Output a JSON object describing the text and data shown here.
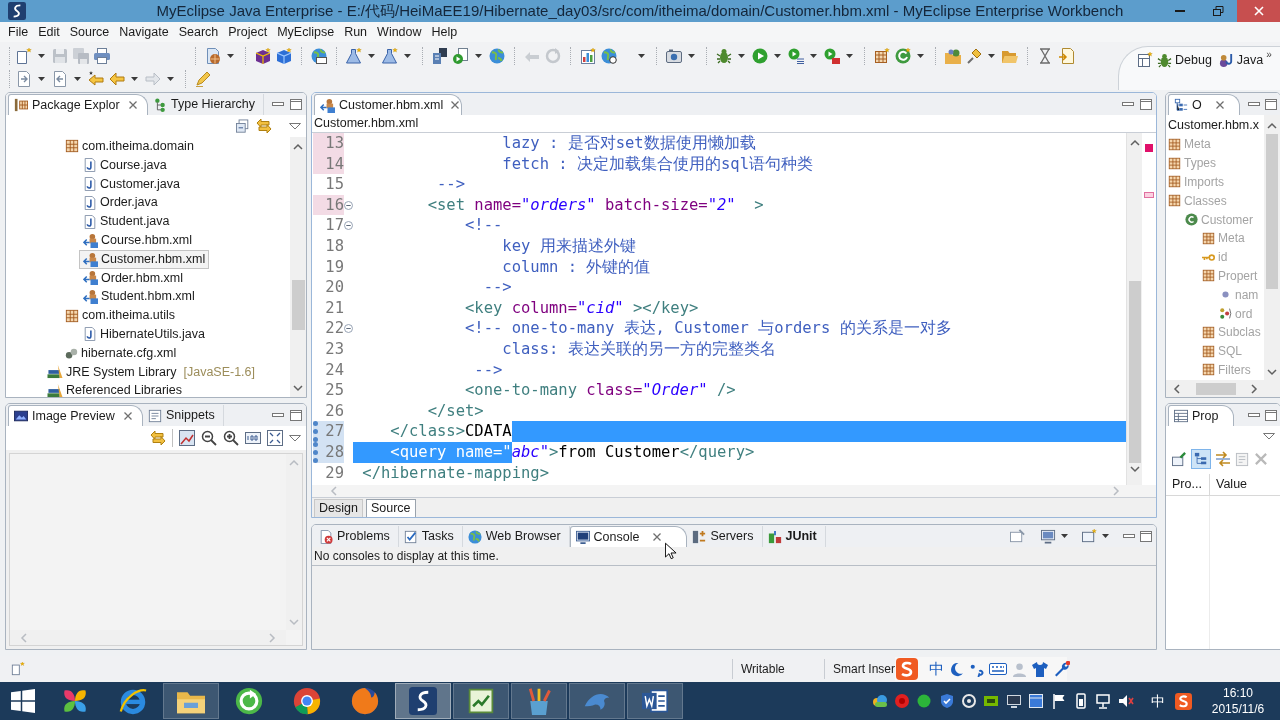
{
  "window": {
    "title": "MyEclipse Java Enterprise - E:/代码/HeiMaEE19/Hibernate_day03/src/com/itheima/domain/Customer.hbm.xml - MyEclipse Enterprise Workbench"
  },
  "menu": [
    "File",
    "Edit",
    "Source",
    "Navigate",
    "Search",
    "Project",
    "MyEclipse",
    "Run",
    "Window",
    "Help"
  ],
  "perspectives": {
    "items": [
      "Debug",
      "Java"
    ],
    "overflow": "»"
  },
  "package_explorer": {
    "tabs": [
      {
        "label": "Package Explor",
        "selected": true,
        "closable": true
      },
      {
        "label": "Type Hierarchy",
        "selected": false,
        "closable": false
      }
    ],
    "tree": [
      {
        "children": [
          {
            "label": "com.itheima.domain",
            "kind": "package",
            "selected": false,
            "children": [
              {
                "label": "Course.java",
                "kind": "java",
                "selected": false
              },
              {
                "label": "Customer.java",
                "kind": "java",
                "selected": false
              },
              {
                "label": "Order.java",
                "kind": "java",
                "selected": false
              },
              {
                "label": "Student.java",
                "kind": "java",
                "selected": false
              },
              {
                "label": "Course.hbm.xml",
                "kind": "mapping",
                "selected": false
              },
              {
                "label": "Customer.hbm.xml",
                "kind": "mapping",
                "selected": true
              },
              {
                "label": "Order.hbm.xml",
                "kind": "mapping",
                "selected": false
              },
              {
                "label": "Student.hbm.xml",
                "kind": "mapping",
                "selected": false
              }
            ]
          },
          {
            "label": "com.itheima.utils",
            "kind": "package",
            "selected": false,
            "children": [
              {
                "label": "HibernateUtils.java",
                "kind": "java",
                "selected": false
              }
            ]
          },
          {
            "label": "hibernate.cfg.xml",
            "kind": "config",
            "selected": false
          }
        ]
      },
      {
        "label": "JRE System Library",
        "decoration": "[JavaSE-1.6]",
        "kind": "library",
        "selected": false
      },
      {
        "label": "Referenced Libraries",
        "kind": "library",
        "selected": false
      }
    ]
  },
  "image_preview": {
    "tabs": [
      {
        "label": "Image Preview",
        "selected": true,
        "closable": true
      },
      {
        "label": "Snippets",
        "selected": false,
        "closable": false
      }
    ]
  },
  "editor": {
    "tabs": [
      {
        "label": "Customer.hbm.xml",
        "selected": true,
        "closable": true
      }
    ],
    "breadcrumb": "Customer.hbm.xml",
    "lines": [
      {
        "number": "13",
        "changed": true,
        "added": false,
        "foldable": false,
        "eol_selected": false,
        "tokens": [
          {
            "kind": "comment",
            "text": "                lazy : 是否对set数据使用懒加载",
            "selected": false
          }
        ]
      },
      {
        "number": "14",
        "changed": true,
        "added": false,
        "foldable": false,
        "eol_selected": false,
        "tokens": [
          {
            "kind": "comment",
            "text": "                fetch : 决定加载集合使用的sql语句种类",
            "selected": false
          }
        ]
      },
      {
        "number": "15",
        "changed": false,
        "added": false,
        "foldable": false,
        "eol_selected": false,
        "tokens": [
          {
            "kind": "comment",
            "text": "         -->",
            "selected": false
          }
        ]
      },
      {
        "number": "16",
        "changed": true,
        "added": false,
        "foldable": true,
        "eol_selected": false,
        "tokens": [
          {
            "kind": "tag",
            "text": "        <set",
            "selected": false
          },
          {
            "kind": "attribute",
            "text": " name=",
            "selected": false
          },
          {
            "kind": "value",
            "text": "\"orders\"",
            "selected": false
          },
          {
            "kind": "attribute",
            "text": " batch-size=",
            "selected": false
          },
          {
            "kind": "value",
            "text": "\"2\"",
            "selected": false
          },
          {
            "kind": "tag",
            "text": "  >",
            "selected": false
          }
        ]
      },
      {
        "number": "17",
        "changed": false,
        "added": false,
        "foldable": true,
        "eol_selected": false,
        "tokens": [
          {
            "kind": "comment",
            "text": "            <!--",
            "selected": false
          }
        ]
      },
      {
        "number": "18",
        "changed": false,
        "added": false,
        "foldable": false,
        "eol_selected": false,
        "tokens": [
          {
            "kind": "comment",
            "text": "                key 用来描述外键",
            "selected": false
          }
        ]
      },
      {
        "number": "19",
        "changed": false,
        "added": false,
        "foldable": false,
        "eol_selected": false,
        "tokens": [
          {
            "kind": "comment",
            "text": "                column : 外键的值",
            "selected": false
          }
        ]
      },
      {
        "number": "20",
        "changed": false,
        "added": false,
        "foldable": false,
        "eol_selected": false,
        "tokens": [
          {
            "kind": "comment",
            "text": "              -->",
            "selected": false
          }
        ]
      },
      {
        "number": "21",
        "changed": false,
        "added": false,
        "foldable": false,
        "eol_selected": false,
        "tokens": [
          {
            "kind": "tag",
            "text": "            <key",
            "selected": false
          },
          {
            "kind": "attribute",
            "text": " column=",
            "selected": false
          },
          {
            "kind": "value",
            "text": "\"cid\"",
            "selected": false
          },
          {
            "kind": "tag",
            "text": " ></key>",
            "selected": false
          }
        ]
      },
      {
        "number": "22",
        "changed": false,
        "added": false,
        "foldable": true,
        "eol_selected": false,
        "tokens": [
          {
            "kind": "comment",
            "text": "            <!-- one-to-many 表达, Customer 与orders 的关系是一对多",
            "selected": false
          }
        ]
      },
      {
        "number": "23",
        "changed": false,
        "added": false,
        "foldable": false,
        "eol_selected": false,
        "tokens": [
          {
            "kind": "comment",
            "text": "                class: 表达关联的另一方的完整类名",
            "selected": false
          }
        ]
      },
      {
        "number": "24",
        "changed": false,
        "added": false,
        "foldable": false,
        "eol_selected": false,
        "tokens": [
          {
            "kind": "comment",
            "text": "             -->",
            "selected": false
          }
        ]
      },
      {
        "number": "25",
        "changed": false,
        "added": false,
        "foldable": false,
        "eol_selected": false,
        "tokens": [
          {
            "kind": "tag",
            "text": "            <one-to-many",
            "selected": false
          },
          {
            "kind": "attribute",
            "text": " class=",
            "selected": false
          },
          {
            "kind": "value",
            "text": "\"Order\"",
            "selected": false
          },
          {
            "kind": "tag",
            "text": " />",
            "selected": false
          }
        ]
      },
      {
        "number": "26",
        "changed": false,
        "added": false,
        "foldable": false,
        "eol_selected": false,
        "tokens": [
          {
            "kind": "tag",
            "text": "        </set>",
            "selected": false
          }
        ]
      },
      {
        "number": "27",
        "changed": false,
        "added": true,
        "foldable": false,
        "eol_selected": true,
        "tokens": [
          {
            "kind": "tag",
            "text": "    </class>",
            "selected": false
          },
          {
            "kind": "text",
            "text": "CDATA",
            "selected": false
          }
        ]
      },
      {
        "number": "28",
        "changed": false,
        "added": true,
        "foldable": false,
        "eol_selected": false,
        "tokens": [
          {
            "kind": "tag",
            "text": "    <query",
            "selected": true
          },
          {
            "kind": "attribute",
            "text": " name=",
            "selected": true
          },
          {
            "kind": "value",
            "text": "\"",
            "selected": true
          },
          {
            "kind": "value",
            "text": "abc\"",
            "selected": false
          },
          {
            "kind": "tag",
            "text": ">",
            "selected": false
          },
          {
            "kind": "text",
            "text": "from Customer",
            "selected": false
          },
          {
            "kind": "tag",
            "text": "</query>",
            "selected": false
          }
        ]
      },
      {
        "number": "29",
        "changed": false,
        "added": false,
        "foldable": false,
        "eol_selected": false,
        "tokens": [
          {
            "kind": "tag",
            "text": " </hibernate-mapping>",
            "selected": false
          }
        ]
      }
    ],
    "mode_tabs": [
      {
        "label": "Design",
        "selected": false
      },
      {
        "label": "Source",
        "selected": true
      }
    ]
  },
  "bottom_panel": {
    "tabs": [
      {
        "label": "Problems",
        "selected": false,
        "closable": false,
        "bold": false
      },
      {
        "label": "Tasks",
        "selected": false,
        "closable": false,
        "bold": false
      },
      {
        "label": "Web Browser",
        "selected": false,
        "closable": false,
        "bold": false
      },
      {
        "label": "Console",
        "selected": true,
        "closable": true,
        "bold": false
      },
      {
        "label": "Servers",
        "selected": false,
        "closable": false,
        "bold": false
      },
      {
        "label": "JUnit",
        "selected": false,
        "closable": false,
        "bold": true
      }
    ],
    "message": "No consoles to display at this time."
  },
  "outline": {
    "tabs": [
      {
        "label": "O",
        "selected": true,
        "closable": true
      }
    ],
    "title": "Customer.hbm.x",
    "dimmed": true,
    "tree": [
      {
        "label": "Meta",
        "kind": "group",
        "selected": false
      },
      {
        "label": "Types",
        "kind": "group",
        "selected": false
      },
      {
        "label": "Imports",
        "kind": "group",
        "selected": false
      },
      {
        "label": "Classes",
        "kind": "group",
        "selected": false,
        "children": [
          {
            "label": "Customer",
            "kind": "class",
            "selected": false,
            "children": [
              {
                "label": "Meta",
                "kind": "group",
                "selected": false
              },
              {
                "label": "id",
                "kind": "key",
                "selected": false
              },
              {
                "label": "Propert",
                "kind": "group",
                "selected": false,
                "children": [
                  {
                    "label": "nam",
                    "kind": "property",
                    "selected": false
                  },
                  {
                    "label": "ord",
                    "kind": "set",
                    "selected": false
                  }
                ]
              },
              {
                "label": "Subclas",
                "kind": "group",
                "selected": false
              },
              {
                "label": "SQL",
                "kind": "group",
                "selected": false
              },
              {
                "label": "Filters",
                "kind": "group",
                "selected": false
              }
            ]
          }
        ]
      }
    ]
  },
  "properties": {
    "tabs": [
      {
        "label": "Prop",
        "selected": true,
        "closable": false
      }
    ],
    "tree_toggle": {
      "pressed": true
    },
    "columns": [
      "Pro...",
      "Value"
    ]
  },
  "status_bar": {
    "fields": [
      "Writable",
      "Smart Inser"
    ]
  },
  "input_method_bar": {
    "mode": "中"
  },
  "taskbar": {
    "apps": [
      {
        "kind": "pinwheel",
        "running": false,
        "selected": false
      },
      {
        "kind": "ie",
        "running": false,
        "selected": false
      },
      {
        "kind": "folder",
        "running": true,
        "selected": false
      },
      {
        "kind": "circle_arrow",
        "running": false,
        "selected": false
      },
      {
        "kind": "chrome",
        "running": false,
        "selected": false
      },
      {
        "kind": "firefox",
        "running": false,
        "selected": false
      },
      {
        "kind": "myeclipse",
        "running": true,
        "selected": true
      },
      {
        "kind": "notepad",
        "running": true,
        "selected": false
      },
      {
        "kind": "pencils",
        "running": true,
        "selected": false
      },
      {
        "kind": "dolphin",
        "running": true,
        "selected": false
      },
      {
        "kind": "word",
        "running": true,
        "selected": false
      }
    ],
    "tray_language": "中",
    "time": "16:10",
    "date": "2015/11/6"
  }
}
